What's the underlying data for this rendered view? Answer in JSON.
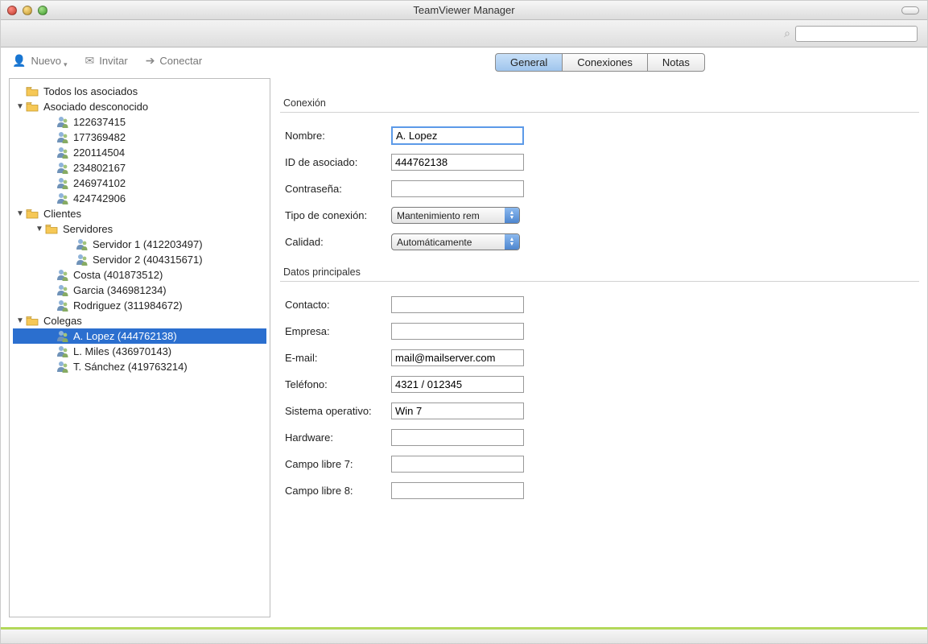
{
  "window": {
    "title": "TeamViewer Manager"
  },
  "toolbar": {
    "new_label": "Nuevo",
    "invite_label": "Invitar",
    "connect_label": "Conectar"
  },
  "tabs": {
    "items": [
      {
        "label": "General"
      },
      {
        "label": "Conexiones"
      },
      {
        "label": "Notas"
      }
    ]
  },
  "tree": {
    "root_label": "Todos los asociados",
    "groups": [
      {
        "label": "Asociado desconocido",
        "children": [
          {
            "label": "122637415"
          },
          {
            "label": "177369482"
          },
          {
            "label": "220114504"
          },
          {
            "label": "234802167"
          },
          {
            "label": "246974102"
          },
          {
            "label": "424742906"
          }
        ]
      },
      {
        "label": "Clientes",
        "children": [
          {
            "label": "Servidores",
            "type": "folder",
            "children": [
              {
                "label": "Servidor 1 (412203497)"
              },
              {
                "label": "Servidor 2 (404315671)"
              }
            ]
          },
          {
            "label": "Costa (401873512)"
          },
          {
            "label": "Garcia (346981234)"
          },
          {
            "label": "Rodriguez (311984672)"
          }
        ]
      },
      {
        "label": "Colegas",
        "children": [
          {
            "label": "A. Lopez (444762138)",
            "selected": true
          },
          {
            "label": "L. Miles (436970143)"
          },
          {
            "label": "T. Sánchez (419763214)"
          }
        ]
      }
    ]
  },
  "sections": {
    "connection_title": "Conexión",
    "main_data_title": "Datos principales"
  },
  "form": {
    "nombre": {
      "label": "Nombre:",
      "value": "A. Lopez"
    },
    "id": {
      "label": "ID de asociado:",
      "value": "444762138"
    },
    "password": {
      "label": "Contraseña:",
      "value": ""
    },
    "conn_type": {
      "label": "Tipo de conexión:",
      "value": "Mantenimiento rem"
    },
    "quality": {
      "label": "Calidad:",
      "value": "Automáticamente"
    },
    "contacto": {
      "label": "Contacto:",
      "value": ""
    },
    "empresa": {
      "label": "Empresa:",
      "value": ""
    },
    "email": {
      "label": "E-mail:",
      "value": "mail@mailserver.com"
    },
    "telefono": {
      "label": "Teléfono:",
      "value": "4321 / 012345"
    },
    "os": {
      "label": "Sistema operativo:",
      "value": "Win 7"
    },
    "hardware": {
      "label": "Hardware:",
      "value": ""
    },
    "campo7": {
      "label": "Campo libre 7:",
      "value": ""
    },
    "campo8": {
      "label": "Campo libre 8:",
      "value": ""
    }
  }
}
